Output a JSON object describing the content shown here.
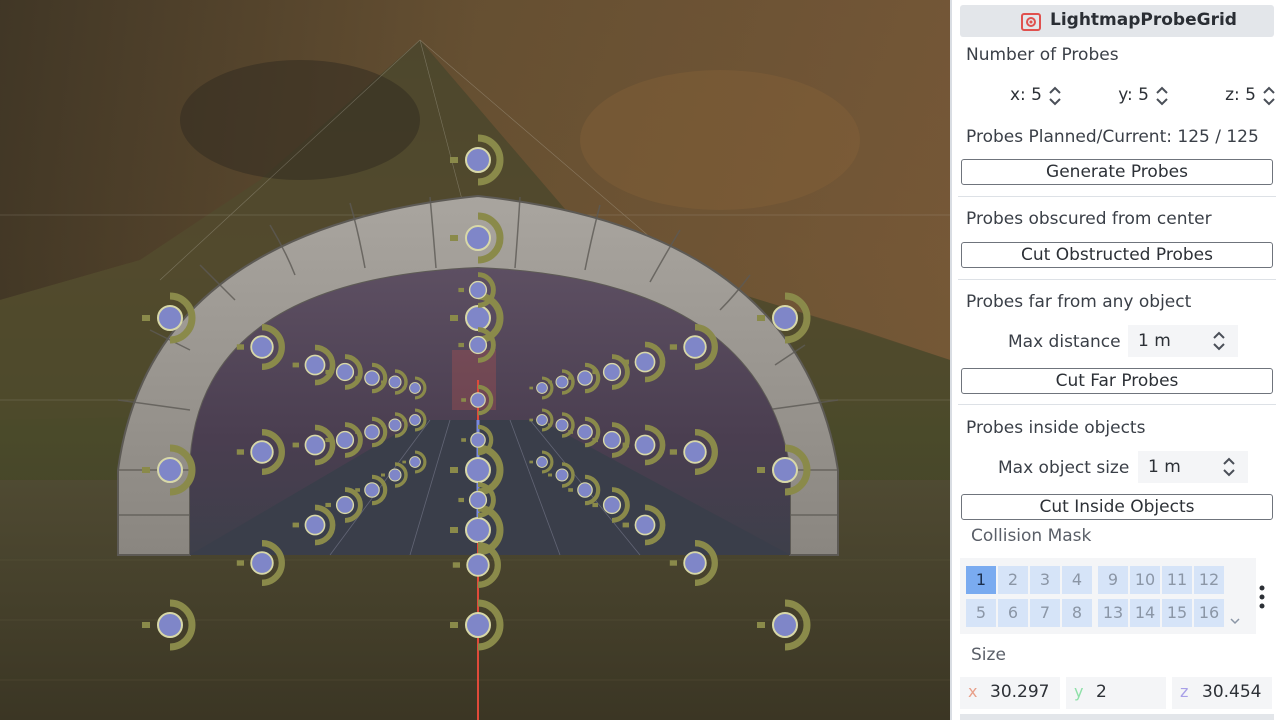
{
  "node": {
    "title": "LightmapProbeGrid",
    "icon": "lightmap-probe-grid-icon",
    "icon_color": "#e0504e"
  },
  "number_of_probes": {
    "label": "Number of Probes",
    "x": "x: 5",
    "y": "y: 5",
    "z": "z: 5"
  },
  "planned": {
    "label": "Probes Planned/Current: 125 / 125"
  },
  "generate_button": "Generate Probes",
  "obscured": {
    "label": "Probes obscured from center",
    "button": "Cut Obstructed Probes"
  },
  "far": {
    "label": "Probes far from any object",
    "max_label": "Max distance",
    "max_value": "1 m",
    "button": "Cut Far Probes"
  },
  "inside": {
    "label": "Probes inside objects",
    "max_label": "Max object size",
    "max_value": "1 m",
    "button": "Cut Inside Objects"
  },
  "collision": {
    "label": "Collision Mask",
    "layers_row1": [
      "1",
      "2",
      "3",
      "4",
      "9",
      "10",
      "11",
      "12"
    ],
    "layers_row2": [
      "5",
      "6",
      "7",
      "8",
      "13",
      "14",
      "15",
      "16"
    ],
    "active_layer": "1"
  },
  "size": {
    "label": "Size",
    "x_axis": "x",
    "x": "30.297",
    "y_axis": "y",
    "y": "2",
    "z_axis": "z",
    "z": "30.454"
  },
  "colors": {
    "accent": "#7aabf0",
    "axis_x": "#e8a08a",
    "axis_y": "#8ee0a8",
    "axis_z": "#a8a0e8",
    "probe_gizmo": "#8a8a4a",
    "probe_sphere": "#7f86c8"
  }
}
